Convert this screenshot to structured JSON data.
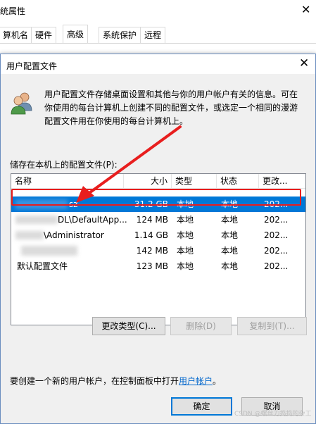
{
  "background_window": {
    "title": "统属性",
    "tabs": [
      "算机名",
      "硬件",
      "高级",
      "系统保护",
      "远程"
    ],
    "active_tab": 2
  },
  "dialog": {
    "title": "用户配置文件",
    "description": "用户配置文件存储桌面设置和其他与你的用户帐户有关的信息。可在你使用的每台计算机上创建不同的配置文件，或选定一个相同的漫游配置文件用在你使用的每台计算机上。",
    "list_label": "储存在本机上的配置文件(P):",
    "columns": [
      "名称",
      "大小",
      "类型",
      "状态",
      "更改..."
    ],
    "rows": [
      {
        "name": "sz",
        "size": "31.2 GB",
        "type": "本地",
        "status": "本地",
        "modified": "202...",
        "selected": true
      },
      {
        "name": "DL\\DefaultApp...",
        "size": "124 MB",
        "type": "本地",
        "status": "本地",
        "modified": "202...",
        "selected": false
      },
      {
        "name": "\\Administrator",
        "size": "1.14 GB",
        "type": "本地",
        "status": "本地",
        "modified": "202...",
        "selected": false
      },
      {
        "name": "",
        "size": "142 MB",
        "type": "本地",
        "status": "本地",
        "modified": "202...",
        "selected": false
      },
      {
        "name": "默认配置文件",
        "size": "123 MB",
        "type": "本地",
        "status": "本地",
        "modified": "202...",
        "selected": false
      }
    ],
    "buttons": {
      "change_type": "更改类型(C)...",
      "delete": "删除(D)",
      "copy_to": "复制到(T)...",
      "ok": "确定",
      "cancel": "取消"
    },
    "hint_prefix": "要创建一个新的用户帐户，在控制面板中打开",
    "hint_link": "用户帐户",
    "hint_suffix": "。"
  },
  "watermark": "CSDN @螺丝刀捣捣的杂工",
  "colors": {
    "selection": "#0078d7",
    "annotation": "#e81e1e",
    "link": "#0066cc"
  }
}
